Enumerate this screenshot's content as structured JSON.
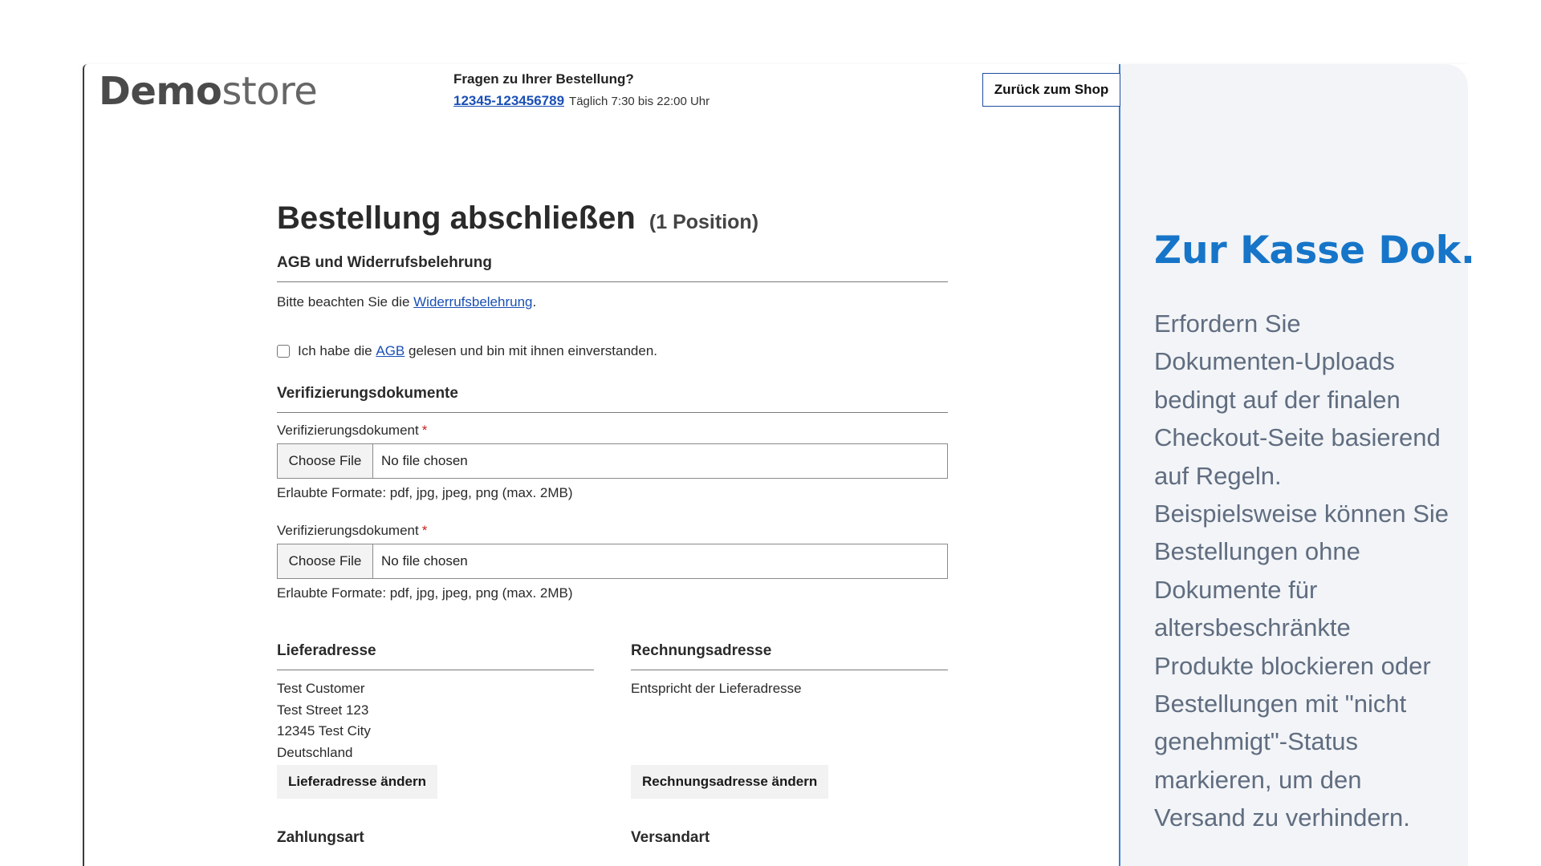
{
  "header": {
    "logo_bold": "Demo",
    "logo_light": "store",
    "contact_question": "Fragen zu Ihrer Bestellung?",
    "phone": "12345-123456789",
    "hours": "Täglich 7:30 bis 22:00 Uhr",
    "back_button": "Zurück zum Shop"
  },
  "main": {
    "title": "Bestellung abschließen",
    "position_count": "(1 Position)",
    "terms": {
      "heading": "AGB und Widerrufsbelehrung",
      "notice_prefix": "Bitte beachten Sie die",
      "notice_link": "Widerrufsbelehrung",
      "notice_suffix": ".",
      "checkbox_prefix": "Ich habe die",
      "checkbox_link": "AGB",
      "checkbox_suffix": "gelesen und bin mit ihnen einverstanden.",
      "checkbox_checked": false
    },
    "verification": {
      "heading": "Verifizierungsdokumente",
      "uploads": [
        {
          "label": "Verifizierungsdokument",
          "required_mark": "*",
          "button": "Choose File",
          "status": "No file chosen",
          "hint": "Erlaubte Formate: pdf, jpg, jpeg, png (max. 2MB)"
        },
        {
          "label": "Verifizierungsdokument",
          "required_mark": "*",
          "button": "Choose File",
          "status": "No file chosen",
          "hint": "Erlaubte Formate: pdf, jpg, jpeg, png (max. 2MB)"
        }
      ]
    },
    "shipping_address": {
      "heading": "Lieferadresse",
      "lines": [
        "Test Customer",
        "Test Street 123",
        "12345 Test City",
        "Deutschland"
      ],
      "button": "Lieferadresse ändern"
    },
    "billing_address": {
      "heading": "Rechnungsadresse",
      "text": "Entspricht der Lieferadresse",
      "button": "Rechnungsadresse ändern"
    },
    "payment": {
      "heading": "Zahlungsart"
    },
    "shipping_method": {
      "heading": "Versandart"
    }
  },
  "sidebar": {
    "title": "Zur Kasse Dok.",
    "text": "Erfordern Sie Dokumenten-Uploads bedingt auf der finalen Checkout-Seite basierend auf Regeln. Beispielsweise können Sie Bestellungen ohne Dokumente für altersbeschränkte Produkte blockieren oder Bestellungen mit \"nicht genehmigt\"-Status markieren, um den Versand zu verhindern."
  },
  "colors": {
    "accent_title": "#1675c8",
    "link": "#1a4fb5",
    "sidebar_bg": "#f2f4f7",
    "required": "#c4221a"
  }
}
